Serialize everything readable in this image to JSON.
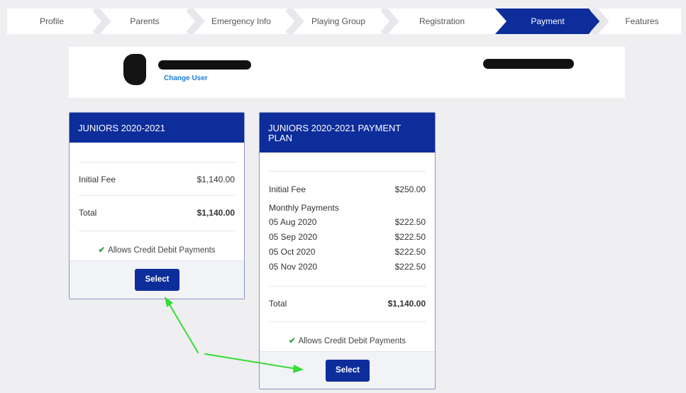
{
  "wizard": {
    "steps": [
      {
        "label": "Profile"
      },
      {
        "label": "Parents"
      },
      {
        "label": "Emergency Info"
      },
      {
        "label": "Playing Group"
      },
      {
        "label": "Registration"
      },
      {
        "label": "Payment",
        "active": true
      },
      {
        "label": "Features"
      }
    ]
  },
  "user": {
    "change_user_label": "Change User"
  },
  "plans": [
    {
      "title": "JUNIORS 2020-2021",
      "initial_fee_label": "Initial Fee",
      "initial_fee_value": "$1,140.00",
      "total_label": "Total",
      "total_value": "$1,140.00",
      "allows_label": "Allows Credit Debit Payments",
      "select_label": "Select"
    },
    {
      "title": "JUNIORS 2020-2021 PAYMENT PLAN",
      "initial_fee_label": "Initial Fee",
      "initial_fee_value": "$250.00",
      "monthly_label": "Monthly Payments",
      "payments": [
        {
          "date": "05 Aug 2020",
          "amount": "$222.50"
        },
        {
          "date": "05 Sep 2020",
          "amount": "$222.50"
        },
        {
          "date": "05 Oct 2020",
          "amount": "$222.50"
        },
        {
          "date": "05 Nov 2020",
          "amount": "$222.50"
        }
      ],
      "total_label": "Total",
      "total_value": "$1,140.00",
      "allows_label": "Allows Credit Debit Payments",
      "select_label": "Select"
    }
  ],
  "colors": {
    "brand": "#0d2d9b",
    "check": "#2ea043",
    "annotation_arrow": "#33dd33"
  }
}
